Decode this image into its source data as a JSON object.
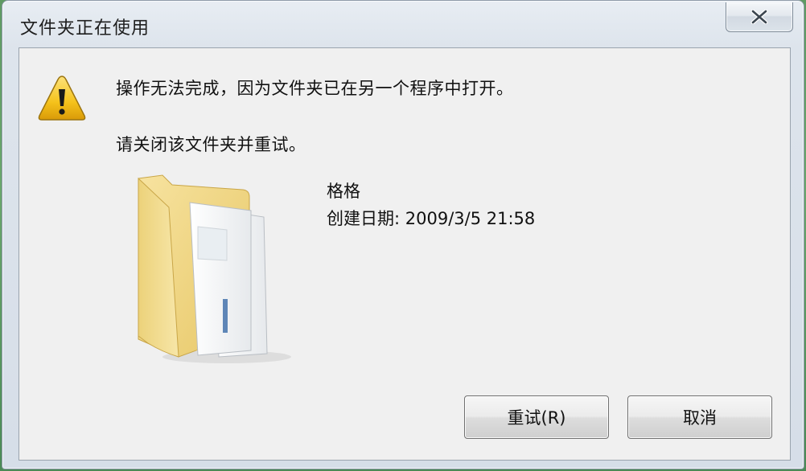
{
  "window": {
    "title": "文件夹正在使用"
  },
  "message": {
    "primary": "操作无法完成，因为文件夹已在另一个程序中打开。",
    "secondary": "请关闭该文件夹并重试。"
  },
  "file": {
    "name": "格格",
    "created": "创建日期: 2009/3/5 21:58"
  },
  "buttons": {
    "retry_label": "重试(R)",
    "cancel_label": "取消"
  },
  "icons": {
    "warning": "warning-icon",
    "folder": "folder-icon",
    "close": "close-icon"
  },
  "colors": {
    "dialog_background": "#f0f0f0",
    "warning_yellow": "#f5c21b",
    "folder_yellow": "#f3d98a"
  }
}
